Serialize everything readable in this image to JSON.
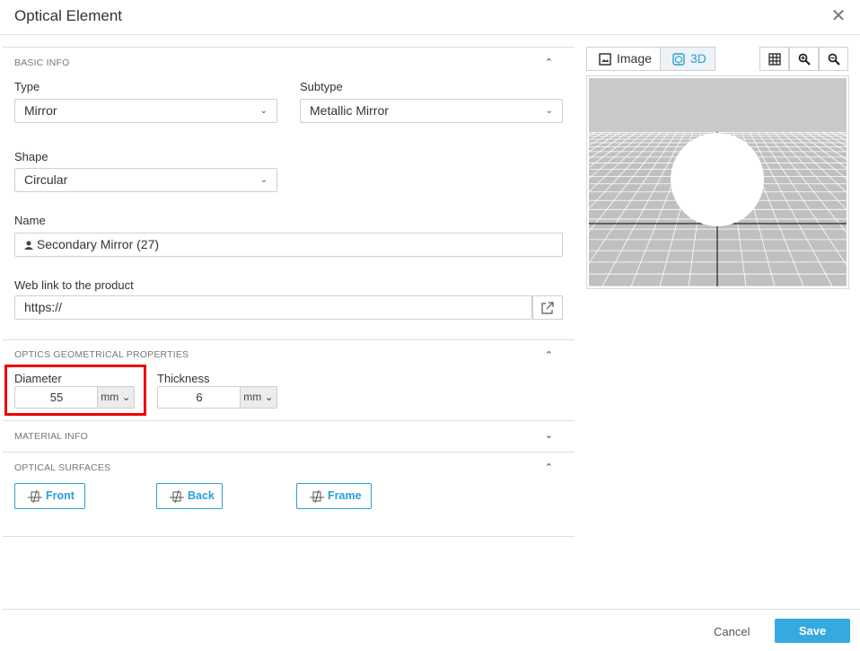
{
  "dialog": {
    "title": "Optical Element"
  },
  "basic_info": {
    "section_title": "BASIC INFO",
    "type_label": "Type",
    "type_value": "Mirror",
    "subtype_label": "Subtype",
    "subtype_value": "Metallic Mirror",
    "shape_label": "Shape",
    "shape_value": "Circular",
    "name_label": "Name",
    "name_value": "Secondary Mirror (27)",
    "weblink_label": "Web link to the product",
    "weblink_value": "https://"
  },
  "geometry": {
    "section_title": "OPTICS GEOMETRICAL PROPERTIES",
    "diameter_label": "Diameter",
    "diameter_value": "55",
    "diameter_unit": "mm",
    "thickness_label": "Thickness",
    "thickness_value": "6",
    "thickness_unit": "mm"
  },
  "material": {
    "section_title": "MATERIAL INFO"
  },
  "surfaces": {
    "section_title": "OPTICAL SURFACES",
    "front_label": "Front",
    "back_label": "Back",
    "frame_label": "Frame"
  },
  "viewer": {
    "image_tab": "Image",
    "three_d_tab": "3D",
    "icons": [
      "grid-icon",
      "zoom-in-icon",
      "zoom-out-icon"
    ]
  },
  "footer": {
    "cancel_label": "Cancel",
    "save_label": "Save"
  },
  "colors": {
    "accent": "#36a9e1",
    "highlight": "#e00000"
  }
}
